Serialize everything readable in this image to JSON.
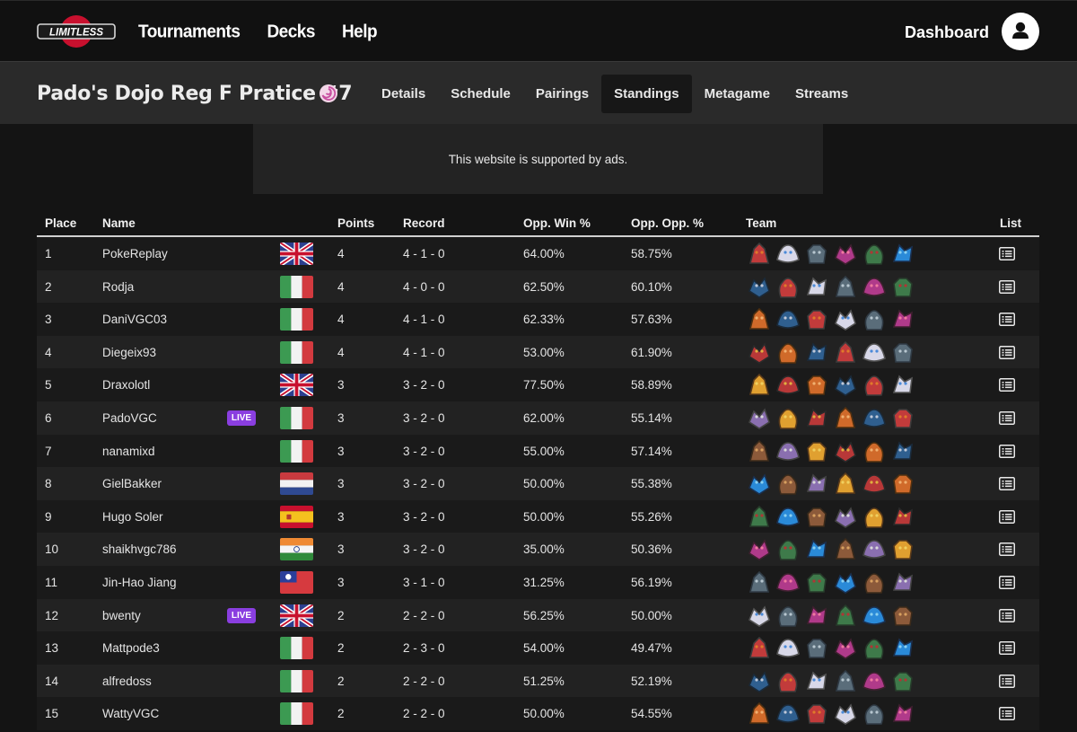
{
  "topbar": {
    "logo_text": "LIMITLESS",
    "nav": [
      "Tournaments",
      "Decks",
      "Help"
    ],
    "dashboard": "Dashboard",
    "avatar_icon": "user-icon"
  },
  "tournament": {
    "title": "Pado's Dojo Reg F Pratice #7",
    "game_icon": "swirl-icon",
    "tabs": [
      "Details",
      "Schedule",
      "Pairings",
      "Standings",
      "Metagame",
      "Streams"
    ],
    "active_tab": "Standings"
  },
  "ad_text": "This website is supported by ads.",
  "table": {
    "headers": {
      "place": "Place",
      "name": "Name",
      "points": "Points",
      "record": "Record",
      "opp_win": "Opp. Win %",
      "opp_opp": "Opp. Opp. %",
      "team": "Team",
      "list": "List"
    },
    "live_label": "LIVE",
    "rows": [
      {
        "place": "1",
        "name": "PokeReplay",
        "live": false,
        "flag": "gb",
        "points": "4",
        "record": "4 - 1 - 0",
        "opp_win": "64.00%",
        "opp_opp": "58.75%"
      },
      {
        "place": "2",
        "name": "Rodja",
        "live": false,
        "flag": "it",
        "points": "4",
        "record": "4 - 0 - 0",
        "opp_win": "62.50%",
        "opp_opp": "60.10%"
      },
      {
        "place": "3",
        "name": "DaniVGC03",
        "live": false,
        "flag": "it",
        "points": "4",
        "record": "4 - 1 - 0",
        "opp_win": "62.33%",
        "opp_opp": "57.63%"
      },
      {
        "place": "4",
        "name": "Diegeix93",
        "live": false,
        "flag": "it",
        "points": "4",
        "record": "4 - 1 - 0",
        "opp_win": "53.00%",
        "opp_opp": "61.90%"
      },
      {
        "place": "5",
        "name": "Draxolotl",
        "live": false,
        "flag": "gb",
        "points": "3",
        "record": "3 - 2 - 0",
        "opp_win": "77.50%",
        "opp_opp": "58.89%"
      },
      {
        "place": "6",
        "name": "PadoVGC",
        "live": true,
        "flag": "it",
        "points": "3",
        "record": "3 - 2 - 0",
        "opp_win": "62.00%",
        "opp_opp": "55.14%"
      },
      {
        "place": "7",
        "name": "nanamixd",
        "live": false,
        "flag": "it",
        "points": "3",
        "record": "3 - 2 - 0",
        "opp_win": "55.00%",
        "opp_opp": "57.14%"
      },
      {
        "place": "8",
        "name": "GielBakker",
        "live": false,
        "flag": "nl",
        "points": "3",
        "record": "3 - 2 - 0",
        "opp_win": "50.00%",
        "opp_opp": "55.38%"
      },
      {
        "place": "9",
        "name": "Hugo Soler",
        "live": false,
        "flag": "es",
        "points": "3",
        "record": "3 - 2 - 0",
        "opp_win": "50.00%",
        "opp_opp": "55.26%"
      },
      {
        "place": "10",
        "name": "shaikhvgc786",
        "live": false,
        "flag": "in",
        "points": "3",
        "record": "3 - 2 - 0",
        "opp_win": "35.00%",
        "opp_opp": "50.36%"
      },
      {
        "place": "11",
        "name": "Jin-Hao Jiang",
        "live": false,
        "flag": "tw",
        "points": "3",
        "record": "3 - 1 - 0",
        "opp_win": "31.25%",
        "opp_opp": "56.19%"
      },
      {
        "place": "12",
        "name": "bwenty",
        "live": true,
        "flag": "gb",
        "points": "2",
        "record": "2 - 2 - 0",
        "opp_win": "56.25%",
        "opp_opp": "50.00%"
      },
      {
        "place": "13",
        "name": "Mattpode3",
        "live": false,
        "flag": "it",
        "points": "2",
        "record": "2 - 3 - 0",
        "opp_win": "54.00%",
        "opp_opp": "49.47%"
      },
      {
        "place": "14",
        "name": "alfredoss",
        "live": false,
        "flag": "it",
        "points": "2",
        "record": "2 - 2 - 0",
        "opp_win": "51.25%",
        "opp_opp": "52.19%"
      },
      {
        "place": "15",
        "name": "WattyVGC",
        "live": false,
        "flag": "it",
        "points": "2",
        "record": "2 - 2 - 0",
        "opp_win": "50.00%",
        "opp_opp": "54.55%"
      }
    ]
  },
  "colors": {
    "page_bg": "#141414",
    "topbar_bg": "#111111",
    "tourbar_bg": "#2a2a2a",
    "live_badge": "#8a3ee0"
  }
}
